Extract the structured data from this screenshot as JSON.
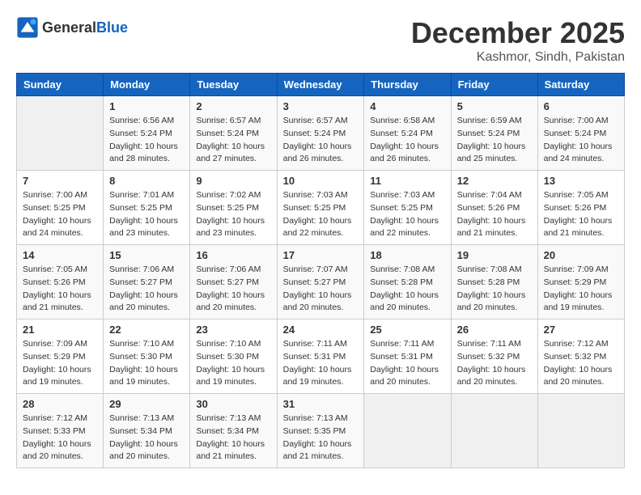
{
  "header": {
    "logo_general": "General",
    "logo_blue": "Blue",
    "month": "December 2025",
    "location": "Kashmor, Sindh, Pakistan"
  },
  "weekdays": [
    "Sunday",
    "Monday",
    "Tuesday",
    "Wednesday",
    "Thursday",
    "Friday",
    "Saturday"
  ],
  "weeks": [
    [
      {
        "day": "",
        "info": ""
      },
      {
        "day": "1",
        "info": "Sunrise: 6:56 AM\nSunset: 5:24 PM\nDaylight: 10 hours\nand 28 minutes."
      },
      {
        "day": "2",
        "info": "Sunrise: 6:57 AM\nSunset: 5:24 PM\nDaylight: 10 hours\nand 27 minutes."
      },
      {
        "day": "3",
        "info": "Sunrise: 6:57 AM\nSunset: 5:24 PM\nDaylight: 10 hours\nand 26 minutes."
      },
      {
        "day": "4",
        "info": "Sunrise: 6:58 AM\nSunset: 5:24 PM\nDaylight: 10 hours\nand 26 minutes."
      },
      {
        "day": "5",
        "info": "Sunrise: 6:59 AM\nSunset: 5:24 PM\nDaylight: 10 hours\nand 25 minutes."
      },
      {
        "day": "6",
        "info": "Sunrise: 7:00 AM\nSunset: 5:24 PM\nDaylight: 10 hours\nand 24 minutes."
      }
    ],
    [
      {
        "day": "7",
        "info": "Sunrise: 7:00 AM\nSunset: 5:25 PM\nDaylight: 10 hours\nand 24 minutes."
      },
      {
        "day": "8",
        "info": "Sunrise: 7:01 AM\nSunset: 5:25 PM\nDaylight: 10 hours\nand 23 minutes."
      },
      {
        "day": "9",
        "info": "Sunrise: 7:02 AM\nSunset: 5:25 PM\nDaylight: 10 hours\nand 23 minutes."
      },
      {
        "day": "10",
        "info": "Sunrise: 7:03 AM\nSunset: 5:25 PM\nDaylight: 10 hours\nand 22 minutes."
      },
      {
        "day": "11",
        "info": "Sunrise: 7:03 AM\nSunset: 5:25 PM\nDaylight: 10 hours\nand 22 minutes."
      },
      {
        "day": "12",
        "info": "Sunrise: 7:04 AM\nSunset: 5:26 PM\nDaylight: 10 hours\nand 21 minutes."
      },
      {
        "day": "13",
        "info": "Sunrise: 7:05 AM\nSunset: 5:26 PM\nDaylight: 10 hours\nand 21 minutes."
      }
    ],
    [
      {
        "day": "14",
        "info": "Sunrise: 7:05 AM\nSunset: 5:26 PM\nDaylight: 10 hours\nand 21 minutes."
      },
      {
        "day": "15",
        "info": "Sunrise: 7:06 AM\nSunset: 5:27 PM\nDaylight: 10 hours\nand 20 minutes."
      },
      {
        "day": "16",
        "info": "Sunrise: 7:06 AM\nSunset: 5:27 PM\nDaylight: 10 hours\nand 20 minutes."
      },
      {
        "day": "17",
        "info": "Sunrise: 7:07 AM\nSunset: 5:27 PM\nDaylight: 10 hours\nand 20 minutes."
      },
      {
        "day": "18",
        "info": "Sunrise: 7:08 AM\nSunset: 5:28 PM\nDaylight: 10 hours\nand 20 minutes."
      },
      {
        "day": "19",
        "info": "Sunrise: 7:08 AM\nSunset: 5:28 PM\nDaylight: 10 hours\nand 20 minutes."
      },
      {
        "day": "20",
        "info": "Sunrise: 7:09 AM\nSunset: 5:29 PM\nDaylight: 10 hours\nand 19 minutes."
      }
    ],
    [
      {
        "day": "21",
        "info": "Sunrise: 7:09 AM\nSunset: 5:29 PM\nDaylight: 10 hours\nand 19 minutes."
      },
      {
        "day": "22",
        "info": "Sunrise: 7:10 AM\nSunset: 5:30 PM\nDaylight: 10 hours\nand 19 minutes."
      },
      {
        "day": "23",
        "info": "Sunrise: 7:10 AM\nSunset: 5:30 PM\nDaylight: 10 hours\nand 19 minutes."
      },
      {
        "day": "24",
        "info": "Sunrise: 7:11 AM\nSunset: 5:31 PM\nDaylight: 10 hours\nand 19 minutes."
      },
      {
        "day": "25",
        "info": "Sunrise: 7:11 AM\nSunset: 5:31 PM\nDaylight: 10 hours\nand 20 minutes."
      },
      {
        "day": "26",
        "info": "Sunrise: 7:11 AM\nSunset: 5:32 PM\nDaylight: 10 hours\nand 20 minutes."
      },
      {
        "day": "27",
        "info": "Sunrise: 7:12 AM\nSunset: 5:32 PM\nDaylight: 10 hours\nand 20 minutes."
      }
    ],
    [
      {
        "day": "28",
        "info": "Sunrise: 7:12 AM\nSunset: 5:33 PM\nDaylight: 10 hours\nand 20 minutes."
      },
      {
        "day": "29",
        "info": "Sunrise: 7:13 AM\nSunset: 5:34 PM\nDaylight: 10 hours\nand 20 minutes."
      },
      {
        "day": "30",
        "info": "Sunrise: 7:13 AM\nSunset: 5:34 PM\nDaylight: 10 hours\nand 21 minutes."
      },
      {
        "day": "31",
        "info": "Sunrise: 7:13 AM\nSunset: 5:35 PM\nDaylight: 10 hours\nand 21 minutes."
      },
      {
        "day": "",
        "info": ""
      },
      {
        "day": "",
        "info": ""
      },
      {
        "day": "",
        "info": ""
      }
    ]
  ]
}
